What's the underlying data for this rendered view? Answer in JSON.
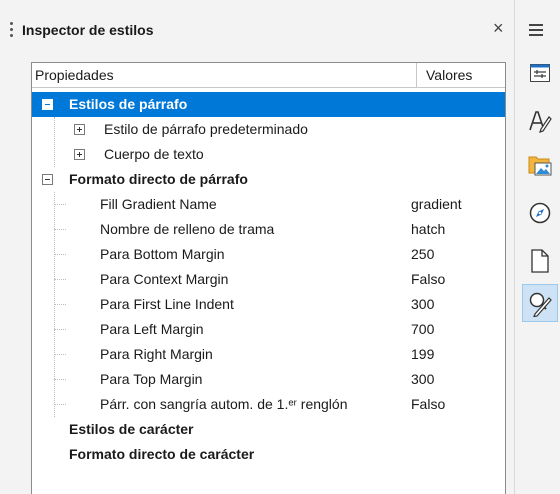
{
  "panel": {
    "title": "Inspector de estilos",
    "close_glyph": "×"
  },
  "tree": {
    "columns": {
      "properties": "Propiedades",
      "values": "Valores"
    },
    "rows": [
      {
        "label": "Estilos de párrafo",
        "value": "",
        "level": 0,
        "expander": "minus",
        "bold": true,
        "selected": true
      },
      {
        "label": "Estilo de párrafo predeterminado",
        "value": "",
        "level": 1,
        "expander": "plus",
        "bold": false
      },
      {
        "label": "Cuerpo de texto",
        "value": "",
        "level": 1,
        "expander": "plus",
        "bold": false
      },
      {
        "label": "Formato directo de párrafo",
        "value": "",
        "level": 0,
        "expander": "minus",
        "bold": true
      },
      {
        "label": "Fill Gradient Name",
        "value": "gradient",
        "level": 2
      },
      {
        "label": "Nombre de relleno de trama",
        "value": "hatch",
        "level": 2
      },
      {
        "label": "Para Bottom Margin",
        "value": "250",
        "level": 2
      },
      {
        "label": "Para Context Margin",
        "value": "Falso",
        "level": 2
      },
      {
        "label": "Para First Line Indent",
        "value": "300",
        "level": 2
      },
      {
        "label": "Para Left Margin",
        "value": "700",
        "level": 2
      },
      {
        "label": "Para Right Margin",
        "value": "199",
        "level": 2
      },
      {
        "label": "Para Top Margin",
        "value": "300",
        "level": 2
      },
      {
        "label": "Párr. con sangría autom. de 1.ᵉʳ renglón",
        "value": "Falso",
        "level": 2
      },
      {
        "label": "Estilos de carácter",
        "value": "",
        "level": 0,
        "bold": true
      },
      {
        "label": "Formato directo de carácter",
        "value": "",
        "level": 0,
        "bold": true
      }
    ]
  },
  "sidebar": {
    "items": [
      {
        "icon": "properties-icon",
        "active": false
      },
      {
        "icon": "styles-icon",
        "active": false
      },
      {
        "icon": "gallery-icon",
        "active": false
      },
      {
        "icon": "navigator-icon",
        "active": false
      },
      {
        "icon": "page-icon",
        "active": false
      },
      {
        "icon": "style-inspector-icon",
        "active": true
      }
    ]
  },
  "colors": {
    "selection": "#0078d7",
    "active_tab": "#cde3f5"
  }
}
